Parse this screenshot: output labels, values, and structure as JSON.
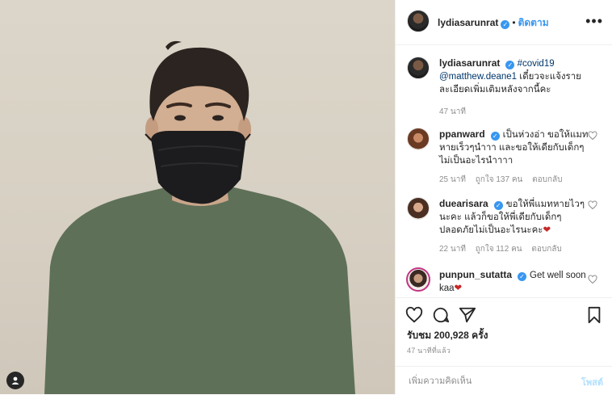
{
  "post": {
    "username": "lydiasarunrat",
    "follow_label": "ติดตาม",
    "dot": "•",
    "more_icon": "more-horizontal-icon"
  },
  "caption": {
    "username": "lydiasarunrat",
    "hashtag": "#covid19",
    "mention": "@matthew.deane1",
    "text": " เดี๋ยวจะแจ้งรายละเอียดเพิ่มเติมหลังจากนี้คะ",
    "time": "47 นาที"
  },
  "comments": [
    {
      "username": "ppanward",
      "text": "เป็นห่วงอ่า ขอให้แมทหายเร็วๆนำาา และขอให้เดียกับเด็กๆไม่เป็นอะไรนำาาา",
      "time": "25 นาที",
      "likes": "ถูกใจ 137 คน",
      "reply": "ตอบกลับ"
    },
    {
      "username": "duearisara",
      "text": "ขอให้พี่แมทหายไวๆนะคะ แล้วก็ขอให้พี่เดียกับเด็กๆปลอดภัยไม่เป็นอะไรนะคะ",
      "emoji": "❤",
      "time": "22 นาที",
      "likes": "ถูกใจ 112 คน",
      "reply": "ตอบกลับ"
    },
    {
      "username": "punpun_sutatta",
      "text": "Get well soon kaa",
      "emoji": "❤"
    }
  ],
  "actions": {
    "likes_label": "รับชม 200,928 ครั้ง",
    "time": "47 นาทีที่แล้ว",
    "comment_placeholder": "เพิ่มความคิดเห็น",
    "post_label": "โพสต์"
  },
  "colors": {
    "accent": "#3897f0",
    "verified": "#3897f0",
    "heart": "#ed4956"
  }
}
